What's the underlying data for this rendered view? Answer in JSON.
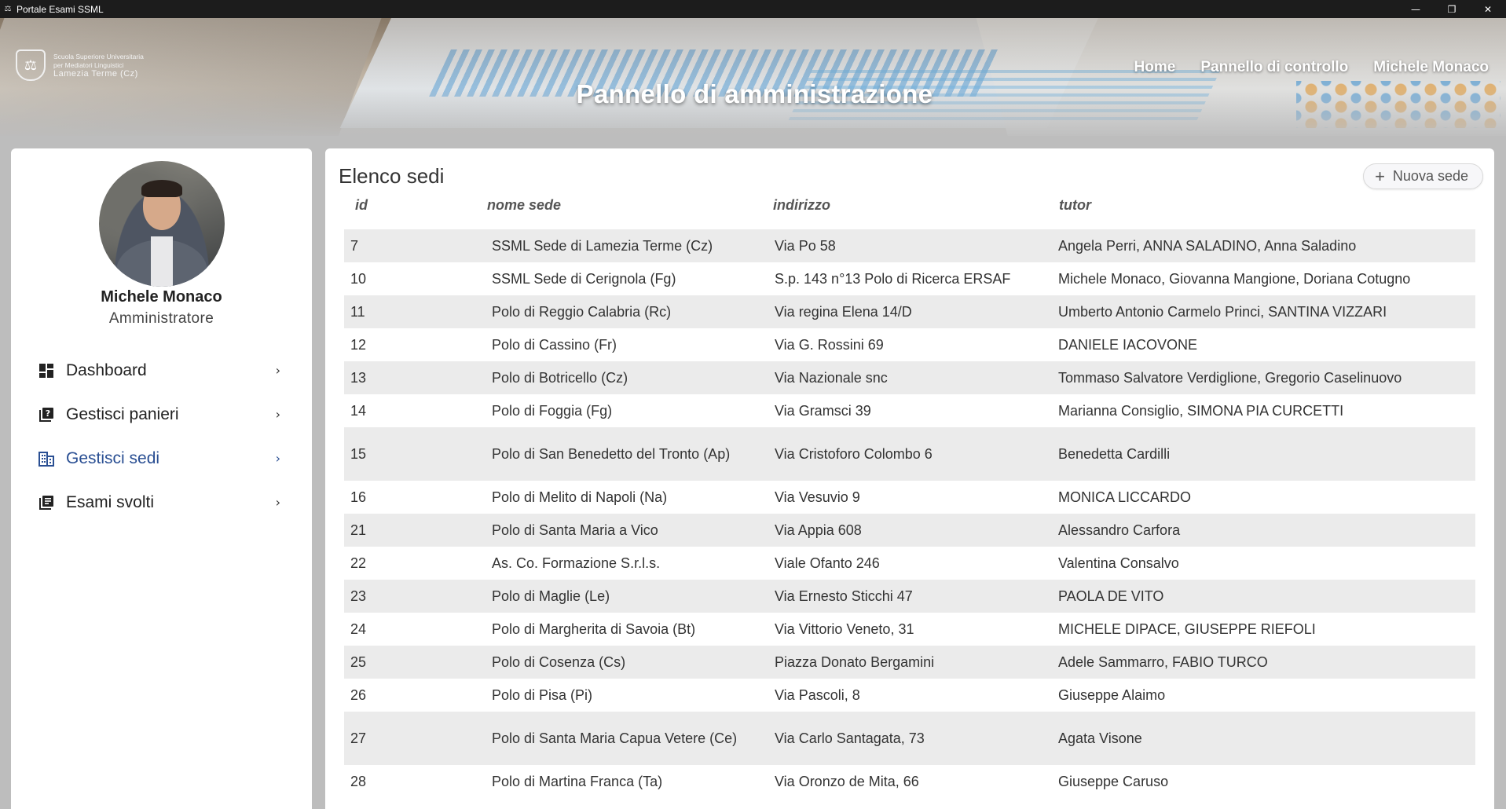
{
  "window": {
    "title": "Portale Esami SSML",
    "controls": {
      "minimize": "—",
      "restore": "❐",
      "close": "✕"
    }
  },
  "header": {
    "logo": {
      "line1": "Scuola Superiore Universitaria",
      "line2": "per Mediatori Linguistici",
      "line3": "Lamezia Terme (Cz)"
    },
    "title": "Pannello di amministrazione",
    "nav": [
      {
        "label": "Home"
      },
      {
        "label": "Pannello di controllo"
      },
      {
        "label": "Michele Monaco"
      }
    ]
  },
  "sidebar": {
    "user": {
      "name": "Michele Monaco",
      "role": "Amministratore"
    },
    "items": [
      {
        "label": "Dashboard",
        "icon": "dashboard-icon",
        "active": false
      },
      {
        "label": "Gestisci panieri",
        "icon": "question-book-icon",
        "active": false
      },
      {
        "label": "Gestisci sedi",
        "icon": "building-icon",
        "active": true
      },
      {
        "label": "Esami svolti",
        "icon": "library-books-icon",
        "active": false
      }
    ],
    "accent_color": "#2a4f93"
  },
  "main": {
    "title": "Elenco sedi",
    "new_button": "Nuova sede",
    "columns": {
      "id": "id",
      "nome": "nome sede",
      "indirizzo": "indirizzo",
      "tutor": "tutor"
    },
    "rows": [
      {
        "id": "7",
        "nome": "SSML Sede di Lamezia Terme (Cz)",
        "indirizzo": "Via Po 58",
        "tutor": "Angela Perri, ANNA SALADINO, Anna Saladino"
      },
      {
        "id": "10",
        "nome": "SSML Sede di Cerignola (Fg)",
        "indirizzo": "S.p. 143 n°13 Polo di Ricerca ERSAF",
        "tutor": "Michele Monaco, Giovanna Mangione, Doriana Cotugno"
      },
      {
        "id": "11",
        "nome": "Polo di Reggio Calabria (Rc)",
        "indirizzo": "Via regina Elena 14/D",
        "tutor": "Umberto Antonio Carmelo Princi, SANTINA VIZZARI"
      },
      {
        "id": "12",
        "nome": "Polo di Cassino (Fr)",
        "indirizzo": "Via G. Rossini 69",
        "tutor": "DANIELE IACOVONE"
      },
      {
        "id": "13",
        "nome": "Polo di Botricello (Cz)",
        "indirizzo": "Via Nazionale snc",
        "tutor": "Tommaso Salvatore Verdiglione, Gregorio Caselinuovo"
      },
      {
        "id": "14",
        "nome": "Polo di Foggia (Fg)",
        "indirizzo": "Via Gramsci 39",
        "tutor": "Marianna Consiglio, SIMONA PIA CURCETTI"
      },
      {
        "id": "15",
        "nome": "Polo di San Benedetto del Tronto (Ap)",
        "indirizzo": "Via Cristoforo Colombo 6",
        "tutor": "Benedetta Cardilli"
      },
      {
        "id": "16",
        "nome": "Polo di Melito di Napoli (Na)",
        "indirizzo": "Via Vesuvio 9",
        "tutor": "MONICA LICCARDO"
      },
      {
        "id": "21",
        "nome": "Polo di Santa Maria a Vico",
        "indirizzo": "Via Appia 608",
        "tutor": "Alessandro Carfora"
      },
      {
        "id": "22",
        "nome": "As. Co. Formazione S.r.l.s.",
        "indirizzo": "Viale Ofanto 246",
        "tutor": "Valentina Consalvo"
      },
      {
        "id": "23",
        "nome": "Polo di Maglie (Le)",
        "indirizzo": "Via Ernesto Sticchi 47",
        "tutor": "PAOLA DE VITO"
      },
      {
        "id": "24",
        "nome": "Polo di Margherita di Savoia (Bt)",
        "indirizzo": "Via Vittorio Veneto, 31",
        "tutor": "MICHELE DIPACE, GIUSEPPE RIEFOLI"
      },
      {
        "id": "25",
        "nome": "Polo di Cosenza (Cs)",
        "indirizzo": "Piazza Donato Bergamini",
        "tutor": "Adele Sammarro, FABIO TURCO"
      },
      {
        "id": "26",
        "nome": "Polo di Pisa (Pi)",
        "indirizzo": "Via Pascoli, 8",
        "tutor": "Giuseppe Alaimo"
      },
      {
        "id": "27",
        "nome": "Polo di Santa Maria Capua Vetere (Ce)",
        "indirizzo": "Via Carlo Santagata, 73",
        "tutor": "Agata Visone"
      },
      {
        "id": "28",
        "nome": "Polo di Martina Franca (Ta)",
        "indirizzo": "Via Oronzo de Mita, 66",
        "tutor": "Giuseppe Caruso"
      }
    ]
  }
}
